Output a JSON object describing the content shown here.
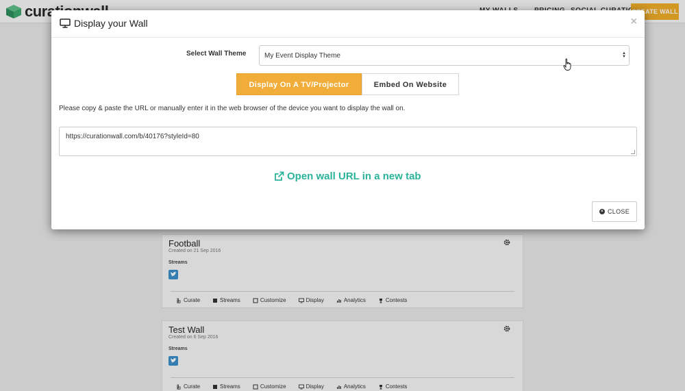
{
  "background": {
    "logo_text": "curationwall",
    "nav": [
      "MY WALLS",
      "PRICING",
      "SOCIAL CURATION"
    ],
    "create_button": "CREATE WALL",
    "cards": [
      {
        "title": "Football",
        "created": "Created on 21 Sep 2016",
        "streams_label": "Streams",
        "actions": [
          "Curate",
          "Streams",
          "Customize",
          "Display",
          "Analytics",
          "Contests"
        ]
      },
      {
        "title": "Test Wall",
        "created": "Created on 6 Sep 2016",
        "streams_label": "Streams",
        "actions": [
          "Curate",
          "Streams",
          "Customize",
          "Display",
          "Analytics",
          "Contests"
        ]
      }
    ]
  },
  "modal": {
    "title": "Display your Wall",
    "close_symbol": "×",
    "theme_label": "Select Wall Theme",
    "theme_selected": "My Event Display Theme",
    "tabs": {
      "active": "Display On A TV/Projector",
      "inactive": "Embed On Website"
    },
    "instructions": "Please copy & paste the URL or manually enter it in the web browser of the device you want to display the wall on.",
    "url": "https://curationwall.com/b/40176?styleId=80",
    "open_link": "Open wall URL in a new tab",
    "close_button": "CLOSE"
  },
  "colors": {
    "accent_orange": "#f0ad3a",
    "link_green": "#2bb39a",
    "twitter_blue": "#3b8fcc"
  }
}
